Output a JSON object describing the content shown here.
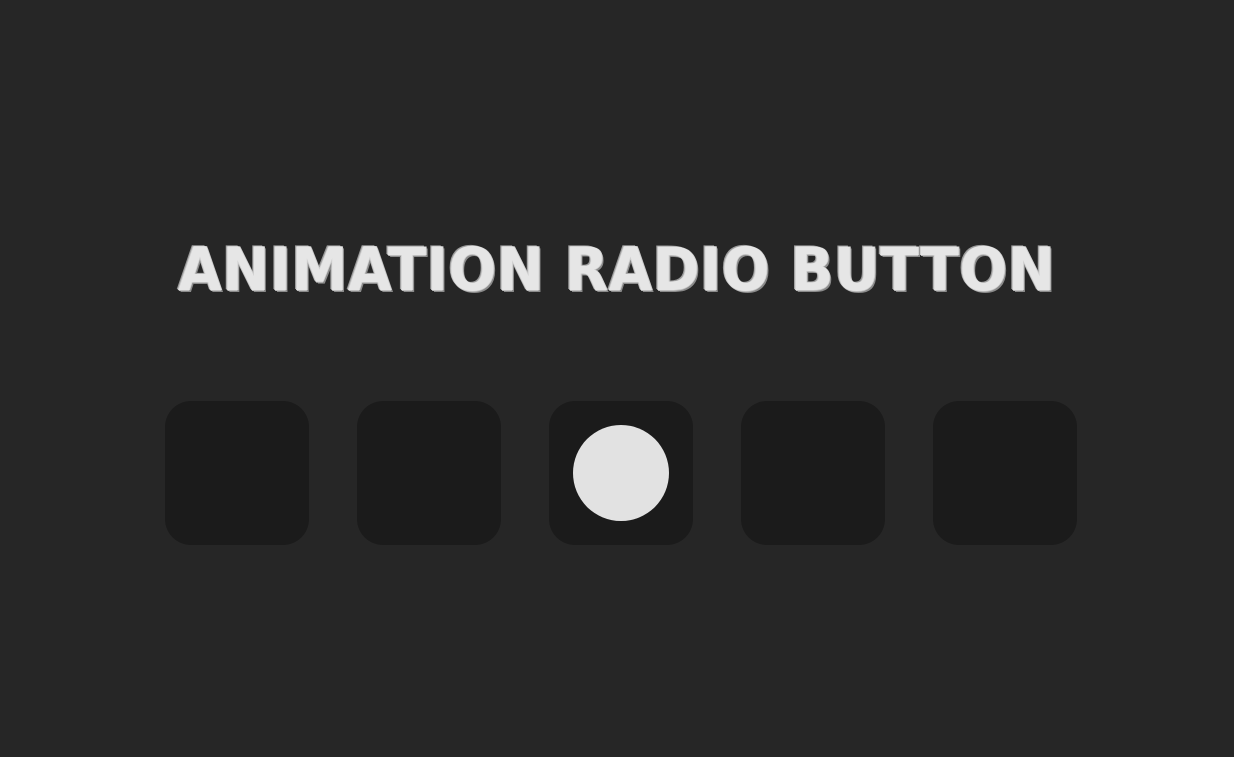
{
  "title": "ANIMATION RADIO BUTTON",
  "colors": {
    "background": "#262626",
    "box": "#1b1b1b",
    "dot": "#e2e2e2",
    "title": "#e6e6e6"
  },
  "radio_options": [
    {
      "selected": false
    },
    {
      "selected": false
    },
    {
      "selected": true
    },
    {
      "selected": false
    },
    {
      "selected": false
    }
  ]
}
